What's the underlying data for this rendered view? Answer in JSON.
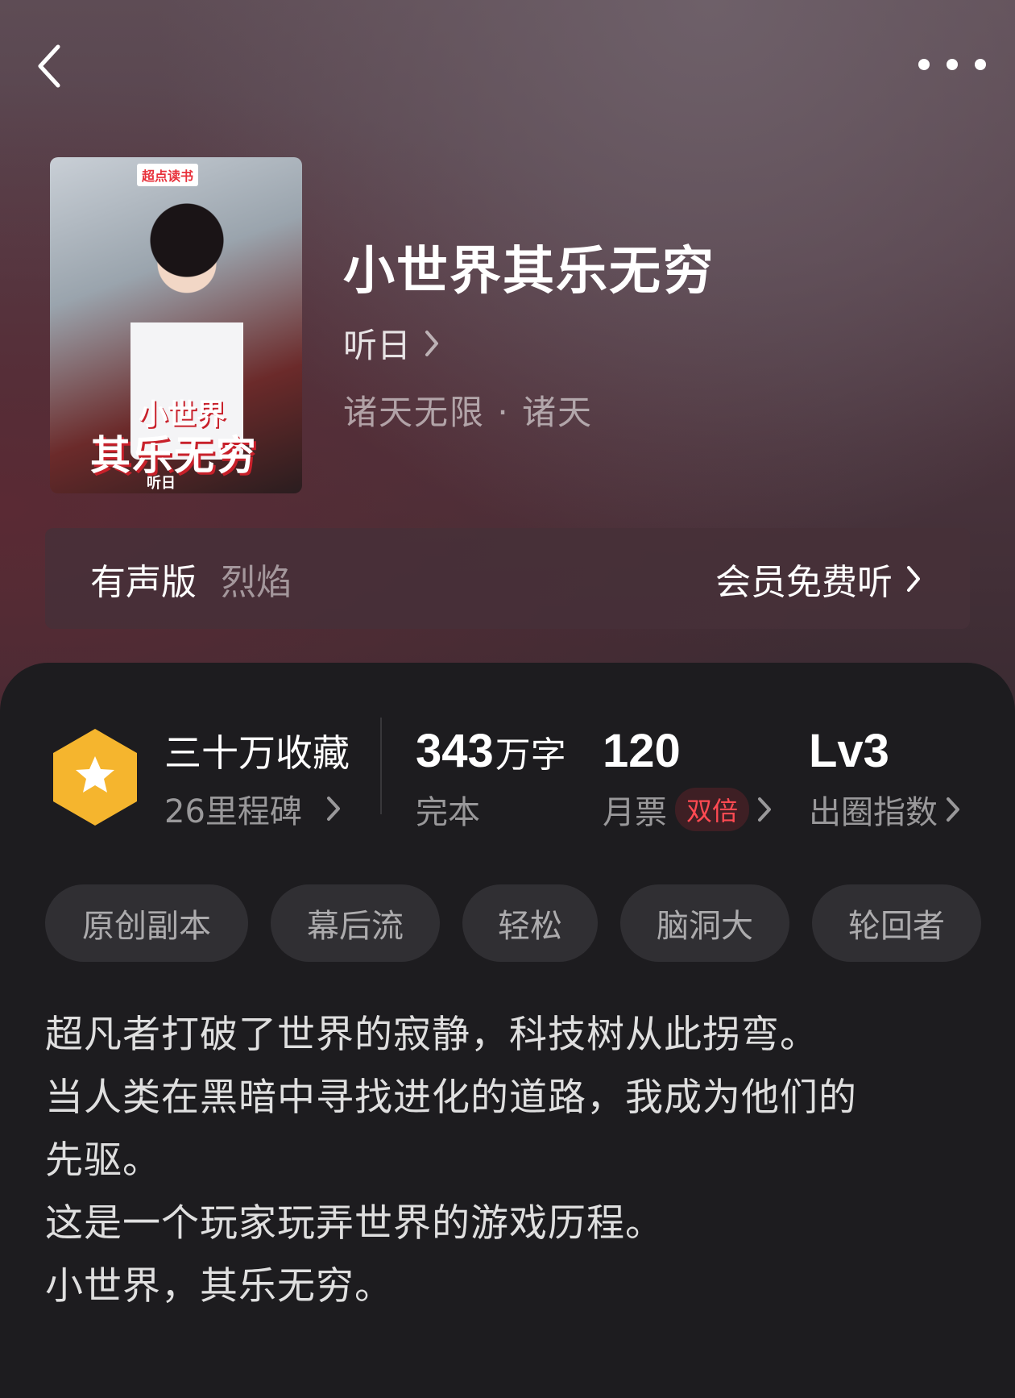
{
  "header": {
    "back_icon": "chevron-left-icon",
    "more_icon": "more-dots-icon"
  },
  "book": {
    "cover_brand": "超点读书",
    "cover_title_line1": "小世界",
    "cover_title_line2": "其乐无穷",
    "cover_author": "听日",
    "title": "小世界其乐无穷",
    "author": "听日",
    "genre": "诸天无限 · 诸天"
  },
  "audio": {
    "label": "有声版",
    "narrator": "烈焰",
    "cta": "会员免费听"
  },
  "stats": {
    "collect_title": "三十万收藏",
    "milestones": "26里程碑",
    "word_count": "343",
    "word_unit": "万字",
    "status": "完本",
    "monthly_votes": "120",
    "monthly_votes_label": "月票",
    "double_badge": "双倍",
    "level": "Lv3",
    "level_label": "出圈指数",
    "badge_color": "#f5b52e"
  },
  "tags": [
    "原创副本",
    "幕后流",
    "轻松",
    "脑洞大",
    "轮回者"
  ],
  "synopsis": [
    "超凡者打破了世界的寂静，科技树从此拐弯。",
    "当人类在黑暗中寻找进化的道路，我成为他们的",
    "先驱。",
    "这是一个玩家玩弄世界的游戏历程。",
    "小世界，其乐无穷。"
  ]
}
